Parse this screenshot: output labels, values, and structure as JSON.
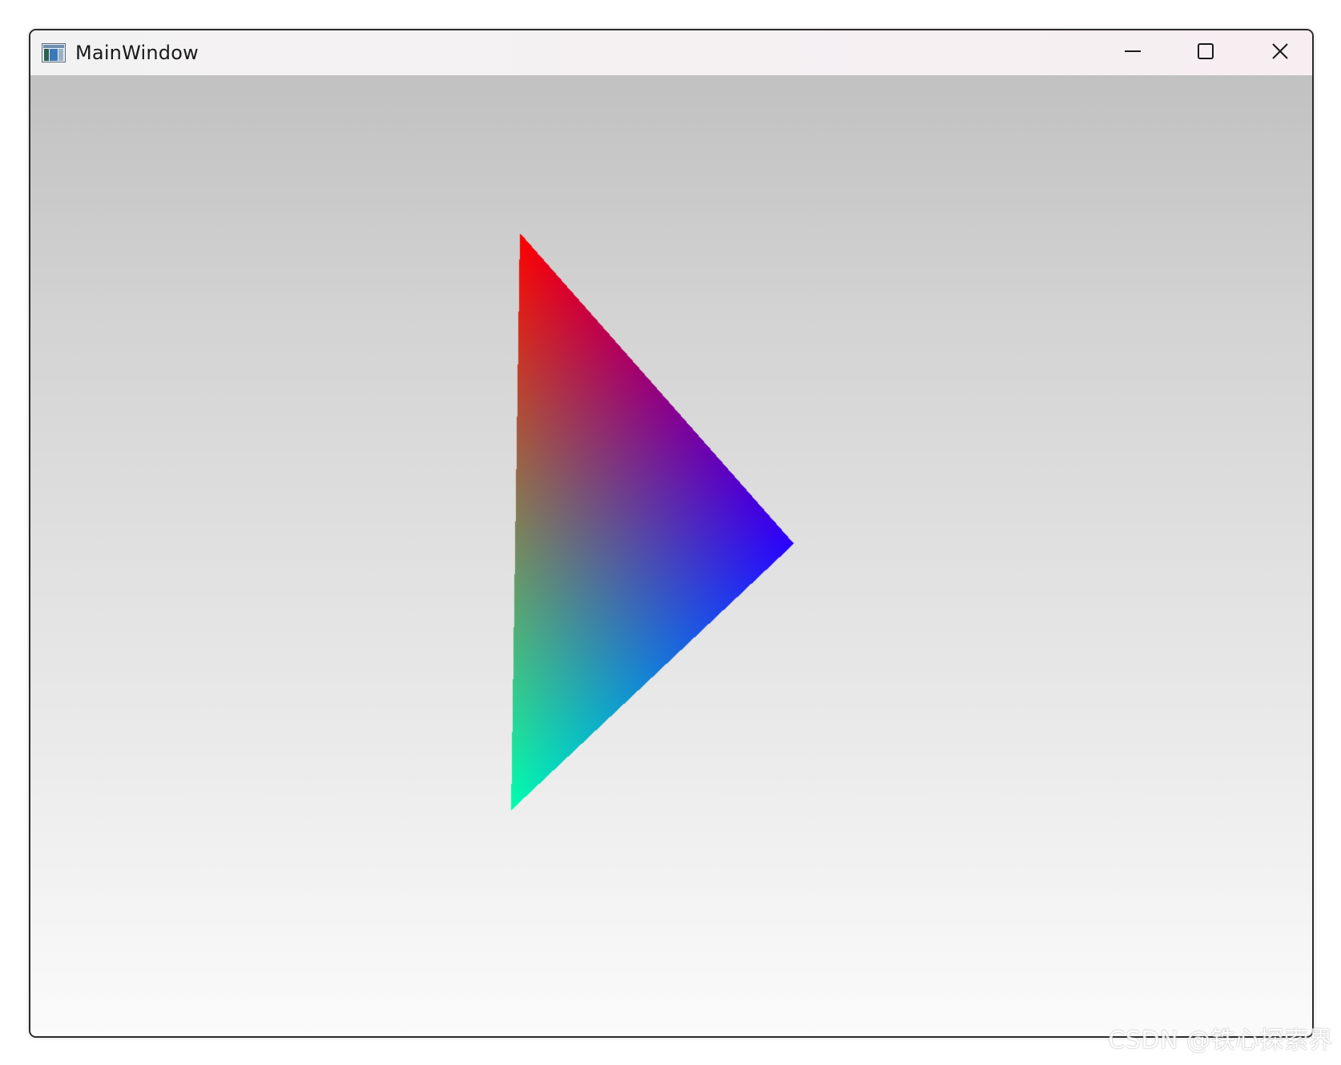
{
  "window": {
    "title": "MainWindow",
    "icon": "app-window-icon",
    "controls": {
      "minimize_icon": "minimize-icon",
      "maximize_icon": "maximize-icon",
      "close_icon": "close-icon"
    }
  },
  "scene": {
    "background_gradient": {
      "top_color": "#c1c1c1",
      "bottom_color": "#fbfbfb"
    },
    "triangle": {
      "vertex_colors": {
        "top": "#ff0000",
        "right": "#2a00ff",
        "bottom": "#00ffb0"
      }
    }
  },
  "watermark": {
    "text": "CSDN @铁心探索界"
  }
}
